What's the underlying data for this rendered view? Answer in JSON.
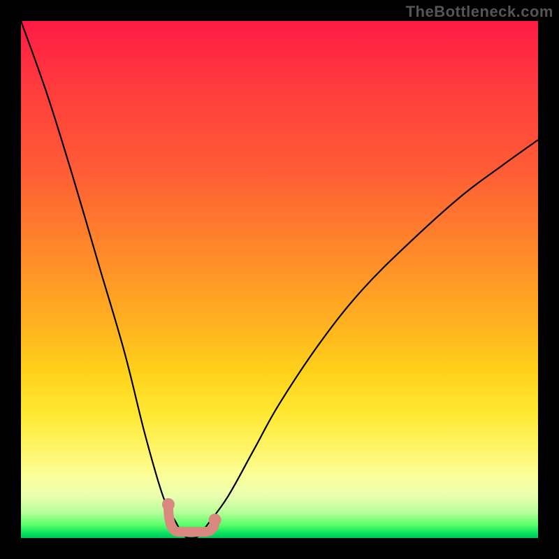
{
  "watermark": "TheBottleneck.com",
  "chart_data": {
    "type": "line",
    "title": "",
    "xlabel": "",
    "ylabel": "",
    "xlim": [
      0,
      1
    ],
    "ylim": [
      0,
      100
    ],
    "grid": false,
    "legend": false,
    "series": [
      {
        "name": "bottleneck-curve",
        "x": [
          0.0,
          0.05,
          0.1,
          0.15,
          0.2,
          0.24,
          0.275,
          0.3,
          0.315,
          0.33,
          0.345,
          0.36,
          0.4,
          0.45,
          0.5,
          0.58,
          0.66,
          0.75,
          0.85,
          0.93,
          1.0
        ],
        "values": [
          100,
          86,
          70,
          53,
          36,
          20,
          8,
          3,
          0.5,
          0,
          0.5,
          2.5,
          8,
          17,
          26,
          38,
          48,
          57,
          66,
          72,
          77
        ]
      }
    ],
    "annotations": {
      "optimal_segment_x": [
        0.285,
        0.375
      ],
      "optimal_segment_y": [
        6.5,
        3.5
      ],
      "dip_bottom_x": [
        0.305,
        0.355
      ],
      "dip_bottom_y": [
        1.2,
        1.2
      ]
    },
    "background_gradient": {
      "top": "#ff1a44",
      "mid": "#ffd21a",
      "bottom": "#00c455"
    }
  }
}
